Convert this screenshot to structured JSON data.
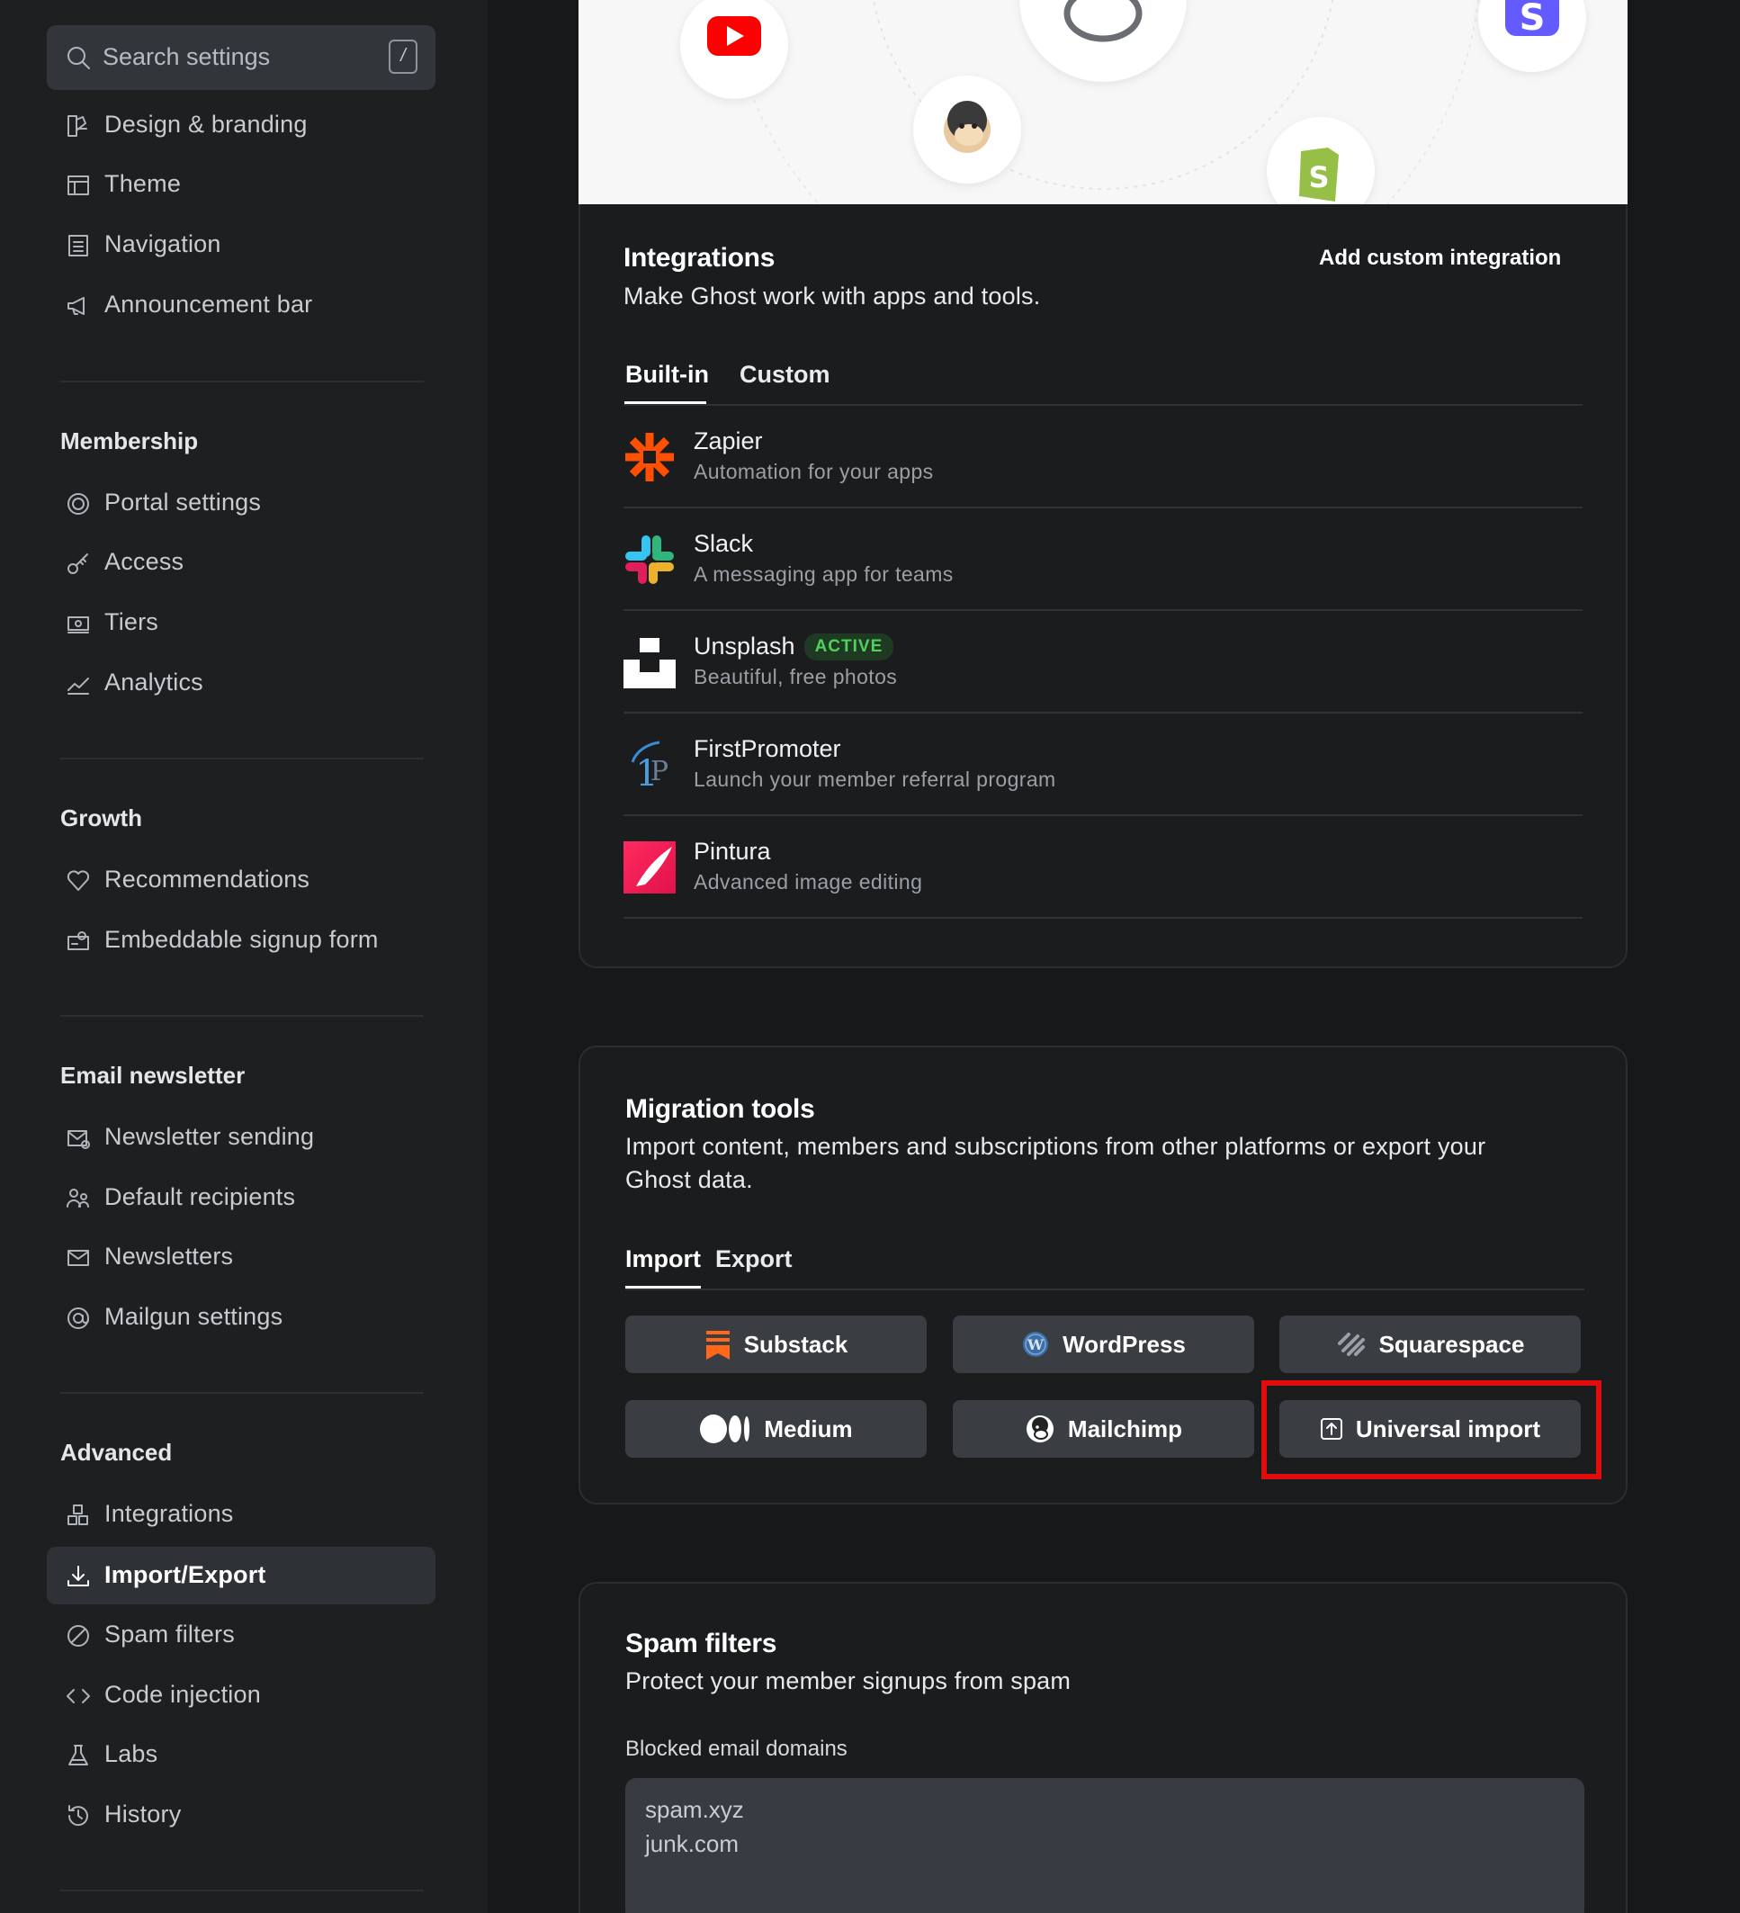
{
  "search": {
    "placeholder": "Search settings",
    "shortcut": "/"
  },
  "sidebar": {
    "site_items": [
      {
        "label": "Design & branding",
        "icon": "brush-icon"
      },
      {
        "label": "Theme",
        "icon": "layout-icon"
      },
      {
        "label": "Navigation",
        "icon": "list-icon"
      },
      {
        "label": "Announcement bar",
        "icon": "megaphone-icon"
      }
    ],
    "membership": {
      "title": "Membership",
      "items": [
        {
          "label": "Portal settings",
          "icon": "portal-icon"
        },
        {
          "label": "Access",
          "icon": "key-icon"
        },
        {
          "label": "Tiers",
          "icon": "tiers-icon"
        },
        {
          "label": "Analytics",
          "icon": "analytics-icon"
        }
      ]
    },
    "growth": {
      "title": "Growth",
      "items": [
        {
          "label": "Recommendations",
          "icon": "heart-icon"
        },
        {
          "label": "Embeddable signup form",
          "icon": "signup-form-icon"
        }
      ]
    },
    "email": {
      "title": "Email newsletter",
      "items": [
        {
          "label": "Newsletter sending",
          "icon": "mail-gear-icon"
        },
        {
          "label": "Default recipients",
          "icon": "users-icon"
        },
        {
          "label": "Newsletters",
          "icon": "envelope-icon"
        },
        {
          "label": "Mailgun settings",
          "icon": "at-icon"
        }
      ]
    },
    "advanced": {
      "title": "Advanced",
      "items": [
        {
          "label": "Integrations",
          "icon": "blocks-icon"
        },
        {
          "label": "Import/Export",
          "icon": "download-icon",
          "active": true
        },
        {
          "label": "Spam filters",
          "icon": "block-icon"
        },
        {
          "label": "Code injection",
          "icon": "code-icon"
        },
        {
          "label": "Labs",
          "icon": "flask-icon"
        },
        {
          "label": "History",
          "icon": "history-icon"
        }
      ]
    }
  },
  "integrations": {
    "title": "Integrations",
    "description": "Make Ghost work with apps and tools.",
    "add_custom": "Add custom integration",
    "tabs": [
      "Built-in",
      "Custom"
    ],
    "active_tab": "Built-in",
    "items": [
      {
        "name": "Zapier",
        "description": "Automation for your apps",
        "icon": "zapier-icon"
      },
      {
        "name": "Slack",
        "description": "A messaging app for teams",
        "icon": "slack-icon"
      },
      {
        "name": "Unsplash",
        "description": "Beautiful, free photos",
        "badge": "ACTIVE",
        "icon": "unsplash-icon"
      },
      {
        "name": "FirstPromoter",
        "description": "Launch your member referral program",
        "icon": "firstpromoter-icon"
      },
      {
        "name": "Pintura",
        "description": "Advanced image editing",
        "icon": "pintura-icon"
      }
    ]
  },
  "migration": {
    "title": "Migration tools",
    "description": "Import content, members and subscriptions from other platforms or export your Ghost data.",
    "tabs": [
      "Import",
      "Export"
    ],
    "active_tab": "Import",
    "buttons": [
      {
        "label": "Substack",
        "icon": "substack-icon"
      },
      {
        "label": "WordPress",
        "icon": "wordpress-icon"
      },
      {
        "label": "Squarespace",
        "icon": "squarespace-icon"
      },
      {
        "label": "Medium",
        "icon": "medium-icon"
      },
      {
        "label": "Mailchimp",
        "icon": "mailchimp-icon"
      },
      {
        "label": "Universal import",
        "icon": "upload-icon",
        "highlighted": true
      }
    ]
  },
  "spam": {
    "title": "Spam filters",
    "description": "Protect your member signups from spam",
    "field_label": "Blocked email domains",
    "domains": [
      "spam.xyz",
      "junk.com"
    ]
  },
  "colors": {
    "background": "#17181a",
    "sidebar": "#1d1f21",
    "button": "#3a3d42",
    "highlight": "#e10d0d",
    "active_badge": "#4fd15a"
  }
}
